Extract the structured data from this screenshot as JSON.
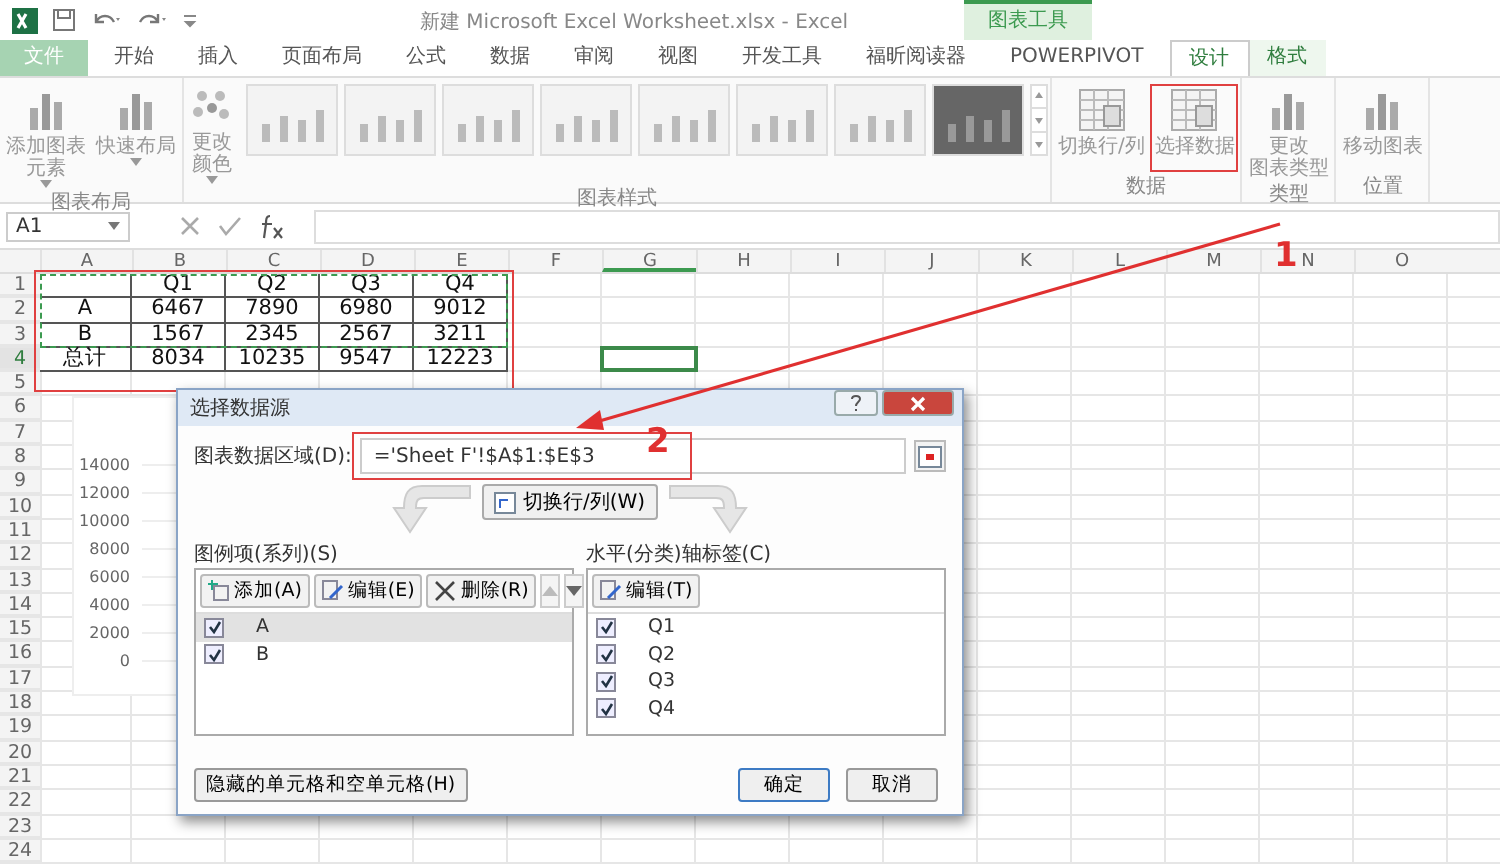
{
  "window": {
    "title": "新建 Microsoft Excel Worksheet.xlsx - Excel",
    "context_group": "图表工具"
  },
  "tabs": [
    {
      "label": "文件",
      "kind": "file",
      "selected": false
    },
    {
      "label": "开始",
      "kind": "normal",
      "selected": false
    },
    {
      "label": "插入",
      "kind": "normal",
      "selected": false
    },
    {
      "label": "页面布局",
      "kind": "normal",
      "selected": false
    },
    {
      "label": "公式",
      "kind": "normal",
      "selected": false
    },
    {
      "label": "数据",
      "kind": "normal",
      "selected": false
    },
    {
      "label": "审阅",
      "kind": "normal",
      "selected": false
    },
    {
      "label": "视图",
      "kind": "normal",
      "selected": false
    },
    {
      "label": "开发工具",
      "kind": "normal",
      "selected": false
    },
    {
      "label": "福昕阅读器",
      "kind": "normal",
      "selected": false
    },
    {
      "label": "POWERPIVOT",
      "kind": "normal",
      "selected": false
    },
    {
      "label": "设计",
      "kind": "context",
      "selected": true
    },
    {
      "label": "格式",
      "kind": "context",
      "selected": false
    }
  ],
  "ribbon": {
    "groups": [
      {
        "label": "图表布局",
        "buttons": [
          {
            "lines": [
              "添加图表",
              "元素"
            ],
            "dropdown": true,
            "highlighted": false
          },
          {
            "lines": [
              "快速布局"
            ],
            "dropdown": true,
            "highlighted": false
          }
        ]
      },
      {
        "label": "图表样式",
        "buttons": [
          {
            "lines": [
              "更改",
              "颜色"
            ],
            "dropdown": true,
            "highlighted": false
          }
        ],
        "styles": [
          {
            "kind": "light"
          },
          {
            "kind": "light"
          },
          {
            "kind": "light"
          },
          {
            "kind": "light"
          },
          {
            "kind": "light"
          },
          {
            "kind": "light"
          },
          {
            "kind": "light"
          },
          {
            "kind": "dark"
          }
        ]
      },
      {
        "label": "数据",
        "buttons": [
          {
            "lines": [
              "切换行/列"
            ],
            "dropdown": false,
            "highlighted": false
          },
          {
            "lines": [
              "选择数据"
            ],
            "dropdown": false,
            "highlighted": true
          }
        ]
      },
      {
        "label": "类型",
        "buttons": [
          {
            "lines": [
              "更改",
              "图表类型"
            ],
            "dropdown": false,
            "highlighted": false
          }
        ]
      },
      {
        "label": "位置",
        "buttons": [
          {
            "lines": [
              "移动图表"
            ],
            "dropdown": false,
            "highlighted": false
          }
        ]
      }
    ]
  },
  "formula_bar": {
    "name_box": "A1"
  },
  "sheet": {
    "columns": [
      {
        "label": "A",
        "selected": false
      },
      {
        "label": "B",
        "selected": false
      },
      {
        "label": "C",
        "selected": false
      },
      {
        "label": "D",
        "selected": false
      },
      {
        "label": "E",
        "selected": false
      },
      {
        "label": "F",
        "selected": false
      },
      {
        "label": "G",
        "selected": true
      },
      {
        "label": "H",
        "selected": false
      },
      {
        "label": "I",
        "selected": false
      },
      {
        "label": "J",
        "selected": false
      },
      {
        "label": "K",
        "selected": false
      },
      {
        "label": "L",
        "selected": false
      },
      {
        "label": "M",
        "selected": false
      },
      {
        "label": "N",
        "selected": false
      },
      {
        "label": "O",
        "selected": false
      }
    ],
    "rows": [
      {
        "label": "1",
        "selected": false
      },
      {
        "label": "2",
        "selected": false
      },
      {
        "label": "3",
        "selected": false
      },
      {
        "label": "4",
        "selected": true
      },
      {
        "label": "5",
        "selected": false
      },
      {
        "label": "6",
        "selected": false
      },
      {
        "label": "7",
        "selected": false
      },
      {
        "label": "8",
        "selected": false
      },
      {
        "label": "9",
        "selected": false
      },
      {
        "label": "10",
        "selected": false
      },
      {
        "label": "11",
        "selected": false
      },
      {
        "label": "12",
        "selected": false
      },
      {
        "label": "13",
        "selected": false
      },
      {
        "label": "14",
        "selected": false
      },
      {
        "label": "15",
        "selected": false
      },
      {
        "label": "16",
        "selected": false
      },
      {
        "label": "17",
        "selected": false
      },
      {
        "label": "18",
        "selected": false
      },
      {
        "label": "19",
        "selected": false
      },
      {
        "label": "20",
        "selected": false
      },
      {
        "label": "21",
        "selected": false
      },
      {
        "label": "22",
        "selected": false
      },
      {
        "label": "23",
        "selected": false
      },
      {
        "label": "24",
        "selected": false
      }
    ],
    "table": {
      "columns": [
        "Q1",
        "Q2",
        "Q3",
        "Q4"
      ],
      "rows": [
        {
          "label": "A",
          "values": [
            "6467",
            "7890",
            "6980",
            "9012"
          ]
        },
        {
          "label": "B",
          "values": [
            "1567",
            "2345",
            "2567",
            "3211"
          ]
        },
        {
          "label": "总计",
          "values": [
            "8034",
            "10235",
            "9547",
            "12223"
          ]
        }
      ]
    },
    "highlighted": true,
    "copied": true
  },
  "chart": {
    "y_axis_labels": [
      "14000",
      "12000",
      "10000",
      "8000",
      "6000",
      "4000",
      "2000",
      "0"
    ]
  },
  "dialog": {
    "title": "选择数据源",
    "range": {
      "label": "图表数据区域(D):",
      "value": "='Sheet F'!$A$1:$E$3",
      "highlighted": true
    },
    "switch_button": "切换行/列(W)",
    "series": {
      "heading": "图例项(系列)(S)",
      "buttons": [
        "添加(A)",
        "编辑(E)",
        "删除(R)"
      ],
      "items": [
        {
          "label": "A",
          "checked": true,
          "selected": true
        },
        {
          "label": "B",
          "checked": true,
          "selected": false
        }
      ]
    },
    "categories": {
      "heading": "水平(分类)轴标签(C)",
      "buttons": [
        "编辑(T)"
      ],
      "items": [
        {
          "label": "Q1",
          "checked": true,
          "selected": false
        },
        {
          "label": "Q2",
          "checked": true,
          "selected": false
        },
        {
          "label": "Q3",
          "checked": true,
          "selected": false
        },
        {
          "label": "Q4",
          "checked": true,
          "selected": false
        }
      ]
    },
    "hidden_cells_button": "隐藏的单元格和空单元格(H)",
    "ok_button": "确定",
    "cancel_button": "取消"
  },
  "callouts": [
    "1",
    "2"
  ]
}
